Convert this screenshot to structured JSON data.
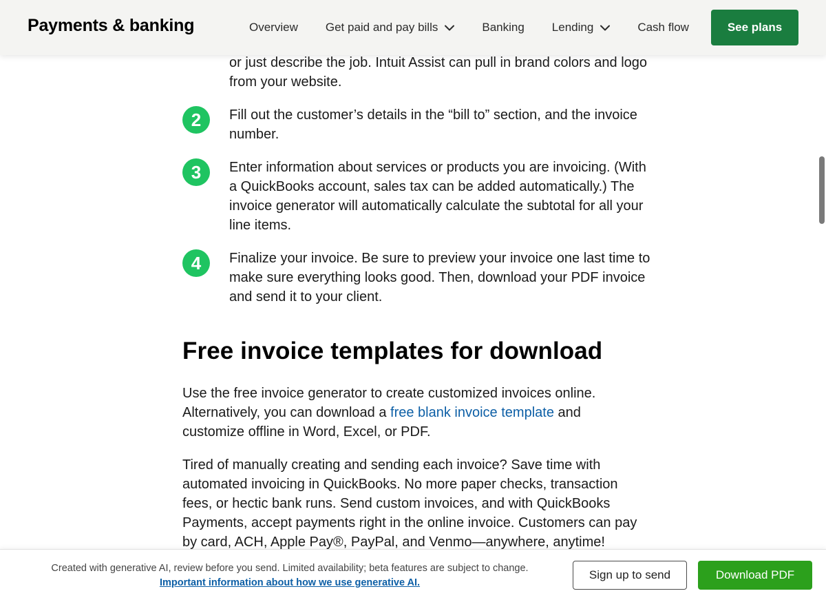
{
  "header": {
    "brand": "Payments & banking",
    "nav": [
      {
        "label": "Overview",
        "has_dropdown": false
      },
      {
        "label": "Get paid and pay bills",
        "has_dropdown": true
      },
      {
        "label": "Banking",
        "has_dropdown": false
      },
      {
        "label": "Lending",
        "has_dropdown": true
      },
      {
        "label": "Cash flow",
        "has_dropdown": false
      }
    ],
    "cta_label": "See plans",
    "cta_color": "#1a7d3f"
  },
  "steps": {
    "fragment": "or just describe the job. Intuit Assist can pull in brand colors and logo from your website.",
    "items": [
      {
        "number": "2",
        "text": "Fill out the customer’s details in the “bill to” section, and the invoice number."
      },
      {
        "number": "3",
        "text": "Enter information about services or products you are invoicing. (With a QuickBooks account, sales tax can be added automatically.) The invoice generator will automatically calculate the subtotal for all your line items."
      },
      {
        "number": "4",
        "text": "Finalize your invoice. Be sure to preview your invoice one last time to make sure everything looks good. Then, download your PDF invoice and send it to your client."
      }
    ],
    "badge_color": "#1fc461"
  },
  "section": {
    "heading": "Free invoice templates for download",
    "para1_before": "Use the free invoice generator to create customized invoices online. Alternatively, you can download a ",
    "para1_link": "free blank invoice template",
    "para1_after": " and customize offline in Word, Excel, or PDF.",
    "para2": "Tired of manually creating and sending each invoice? Save time with automated invoicing in QuickBooks. No more paper checks, transaction fees, or hectic bank runs. Send custom invoices, and with QuickBooks Payments, accept payments right in the online invoice. Customers can pay by card, ACH, Apple Pay®, PayPal, and Venmo—anywhere, anytime!"
  },
  "footer_bar": {
    "disclaimer": "Created with generative AI, review before you send. Limited availability; beta features are subject to change.",
    "ai_link": "Important information about how we use generative AI.",
    "signup_label": "Sign up to send",
    "download_label": "Download PDF",
    "download_color": "#2ca01c"
  }
}
